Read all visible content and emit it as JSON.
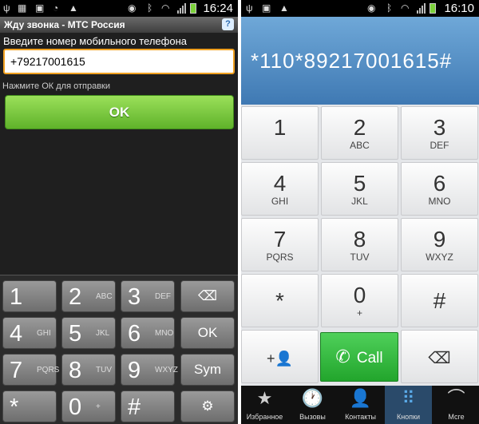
{
  "left": {
    "time": "16:24",
    "title": "Жду звонка - МТС Россия",
    "help_icon": "?",
    "prompt": "Введите номер мобильного телефона",
    "phone_value": "+79217001615",
    "hint": "Нажмите ОК для отправки",
    "ok_label": "OK",
    "keys": [
      {
        "d": "1",
        "l": ""
      },
      {
        "d": "2",
        "l": "ABC"
      },
      {
        "d": "3",
        "l": "DEF"
      },
      {
        "d": "4",
        "l": "GHI"
      },
      {
        "d": "5",
        "l": "JKL"
      },
      {
        "d": "6",
        "l": "MNO"
      },
      {
        "d": "7",
        "l": "PQRS"
      },
      {
        "d": "8",
        "l": "TUV"
      },
      {
        "d": "9",
        "l": "WXYZ"
      },
      {
        "d": "*",
        "l": ""
      },
      {
        "d": "0",
        "l": "+"
      },
      {
        "d": "#",
        "l": ""
      }
    ],
    "side": {
      "backspace": "⌫",
      "ok": "OK",
      "sym": "Sym",
      "settings": "⚙"
    }
  },
  "right": {
    "time": "16:10",
    "display": "*110*89217001615#",
    "keys": [
      {
        "d": "1",
        "l": ""
      },
      {
        "d": "2",
        "l": "ABC"
      },
      {
        "d": "3",
        "l": "DEF"
      },
      {
        "d": "4",
        "l": "GHI"
      },
      {
        "d": "5",
        "l": "JKL"
      },
      {
        "d": "6",
        "l": "MNO"
      },
      {
        "d": "7",
        "l": "PQRS"
      },
      {
        "d": "8",
        "l": "TUV"
      },
      {
        "d": "9",
        "l": "WXYZ"
      },
      {
        "d": "*",
        "l": ""
      },
      {
        "d": "0",
        "l": "+"
      },
      {
        "d": "#",
        "l": ""
      }
    ],
    "add_contact_icon": "+👤",
    "call_label": "Call",
    "call_icon": "✆",
    "backspace_icon": "⌫",
    "nav": [
      {
        "icon": "★",
        "label": "Избранное"
      },
      {
        "icon": "🕐",
        "label": "Вызовы"
      },
      {
        "icon": "👤",
        "label": "Контакты"
      },
      {
        "icon": "⠿",
        "label": "Кнопки"
      },
      {
        "icon": "⌒",
        "label": "Мсге"
      }
    ]
  },
  "colors": {
    "ok_green": "#5fb22a",
    "call_green": "#22a52c",
    "display_blue": "#3f79b3",
    "input_border": "#f0a020"
  }
}
